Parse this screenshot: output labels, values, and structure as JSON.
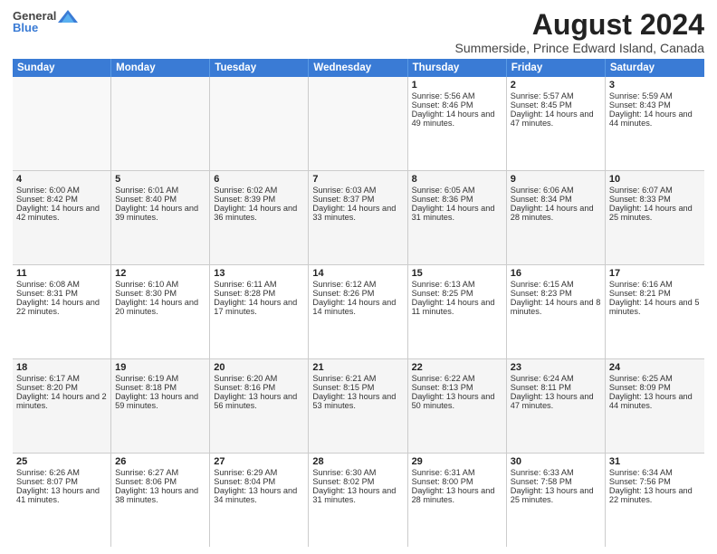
{
  "logo": {
    "general": "General",
    "blue": "Blue"
  },
  "title": "August 2024",
  "subtitle": "Summerside, Prince Edward Island, Canada",
  "days_of_week": [
    "Sunday",
    "Monday",
    "Tuesday",
    "Wednesday",
    "Thursday",
    "Friday",
    "Saturday"
  ],
  "weeks": [
    [
      {
        "day": "",
        "empty": true
      },
      {
        "day": "",
        "empty": true
      },
      {
        "day": "",
        "empty": true
      },
      {
        "day": "",
        "empty": true
      },
      {
        "day": "1",
        "sunrise": "5:56 AM",
        "sunset": "8:46 PM",
        "daylight": "14 hours and 49 minutes."
      },
      {
        "day": "2",
        "sunrise": "5:57 AM",
        "sunset": "8:45 PM",
        "daylight": "14 hours and 47 minutes."
      },
      {
        "day": "3",
        "sunrise": "5:59 AM",
        "sunset": "8:43 PM",
        "daylight": "14 hours and 44 minutes."
      }
    ],
    [
      {
        "day": "4",
        "sunrise": "6:00 AM",
        "sunset": "8:42 PM",
        "daylight": "14 hours and 42 minutes."
      },
      {
        "day": "5",
        "sunrise": "6:01 AM",
        "sunset": "8:40 PM",
        "daylight": "14 hours and 39 minutes."
      },
      {
        "day": "6",
        "sunrise": "6:02 AM",
        "sunset": "8:39 PM",
        "daylight": "14 hours and 36 minutes."
      },
      {
        "day": "7",
        "sunrise": "6:03 AM",
        "sunset": "8:37 PM",
        "daylight": "14 hours and 33 minutes."
      },
      {
        "day": "8",
        "sunrise": "6:05 AM",
        "sunset": "8:36 PM",
        "daylight": "14 hours and 31 minutes."
      },
      {
        "day": "9",
        "sunrise": "6:06 AM",
        "sunset": "8:34 PM",
        "daylight": "14 hours and 28 minutes."
      },
      {
        "day": "10",
        "sunrise": "6:07 AM",
        "sunset": "8:33 PM",
        "daylight": "14 hours and 25 minutes."
      }
    ],
    [
      {
        "day": "11",
        "sunrise": "6:08 AM",
        "sunset": "8:31 PM",
        "daylight": "14 hours and 22 minutes."
      },
      {
        "day": "12",
        "sunrise": "6:10 AM",
        "sunset": "8:30 PM",
        "daylight": "14 hours and 20 minutes."
      },
      {
        "day": "13",
        "sunrise": "6:11 AM",
        "sunset": "8:28 PM",
        "daylight": "14 hours and 17 minutes."
      },
      {
        "day": "14",
        "sunrise": "6:12 AM",
        "sunset": "8:26 PM",
        "daylight": "14 hours and 14 minutes."
      },
      {
        "day": "15",
        "sunrise": "6:13 AM",
        "sunset": "8:25 PM",
        "daylight": "14 hours and 11 minutes."
      },
      {
        "day": "16",
        "sunrise": "6:15 AM",
        "sunset": "8:23 PM",
        "daylight": "14 hours and 8 minutes."
      },
      {
        "day": "17",
        "sunrise": "6:16 AM",
        "sunset": "8:21 PM",
        "daylight": "14 hours and 5 minutes."
      }
    ],
    [
      {
        "day": "18",
        "sunrise": "6:17 AM",
        "sunset": "8:20 PM",
        "daylight": "14 hours and 2 minutes."
      },
      {
        "day": "19",
        "sunrise": "6:19 AM",
        "sunset": "8:18 PM",
        "daylight": "13 hours and 59 minutes."
      },
      {
        "day": "20",
        "sunrise": "6:20 AM",
        "sunset": "8:16 PM",
        "daylight": "13 hours and 56 minutes."
      },
      {
        "day": "21",
        "sunrise": "6:21 AM",
        "sunset": "8:15 PM",
        "daylight": "13 hours and 53 minutes."
      },
      {
        "day": "22",
        "sunrise": "6:22 AM",
        "sunset": "8:13 PM",
        "daylight": "13 hours and 50 minutes."
      },
      {
        "day": "23",
        "sunrise": "6:24 AM",
        "sunset": "8:11 PM",
        "daylight": "13 hours and 47 minutes."
      },
      {
        "day": "24",
        "sunrise": "6:25 AM",
        "sunset": "8:09 PM",
        "daylight": "13 hours and 44 minutes."
      }
    ],
    [
      {
        "day": "25",
        "sunrise": "6:26 AM",
        "sunset": "8:07 PM",
        "daylight": "13 hours and 41 minutes."
      },
      {
        "day": "26",
        "sunrise": "6:27 AM",
        "sunset": "8:06 PM",
        "daylight": "13 hours and 38 minutes."
      },
      {
        "day": "27",
        "sunrise": "6:29 AM",
        "sunset": "8:04 PM",
        "daylight": "13 hours and 34 minutes."
      },
      {
        "day": "28",
        "sunrise": "6:30 AM",
        "sunset": "8:02 PM",
        "daylight": "13 hours and 31 minutes."
      },
      {
        "day": "29",
        "sunrise": "6:31 AM",
        "sunset": "8:00 PM",
        "daylight": "13 hours and 28 minutes."
      },
      {
        "day": "30",
        "sunrise": "6:33 AM",
        "sunset": "7:58 PM",
        "daylight": "13 hours and 25 minutes."
      },
      {
        "day": "31",
        "sunrise": "6:34 AM",
        "sunset": "7:56 PM",
        "daylight": "13 hours and 22 minutes."
      }
    ]
  ]
}
